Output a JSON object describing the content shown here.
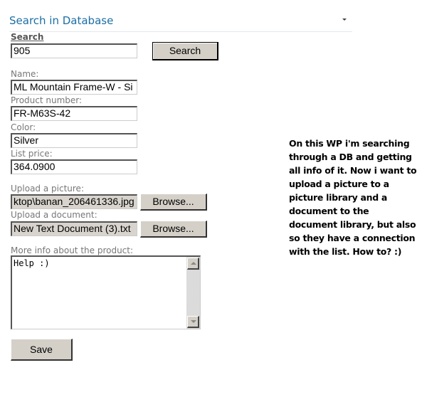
{
  "webpart": {
    "title": "Search in Database",
    "menu_icon": "chevron-down-icon"
  },
  "search": {
    "label": "Search",
    "value": "905",
    "button_label": "Search"
  },
  "fields": {
    "name": {
      "label": "Name:",
      "value": "ML Mountain Frame-W - Si"
    },
    "product_number": {
      "label": "Product number:",
      "value": "FR-M63S-42"
    },
    "color": {
      "label": "Color:",
      "value": "Silver"
    },
    "list_price": {
      "label": "List price:",
      "value": "364.0900"
    }
  },
  "uploads": {
    "picture": {
      "label": "Upload a picture:",
      "value": "ktop\\banan_206461336.jpg",
      "button_label": "Browse..."
    },
    "document": {
      "label": "Upload a document:",
      "value": "New Text Document (3).txt",
      "button_label": "Browse..."
    }
  },
  "more_info": {
    "label": "More info about the product:",
    "value": "Help :)"
  },
  "save_label": "Save",
  "note": "On this WP i'm searching through a DB and getting all info of it. Now i want to upload a picture to a picture library and a document to the document library, but also so they have a connection with the list. How to? :)"
}
